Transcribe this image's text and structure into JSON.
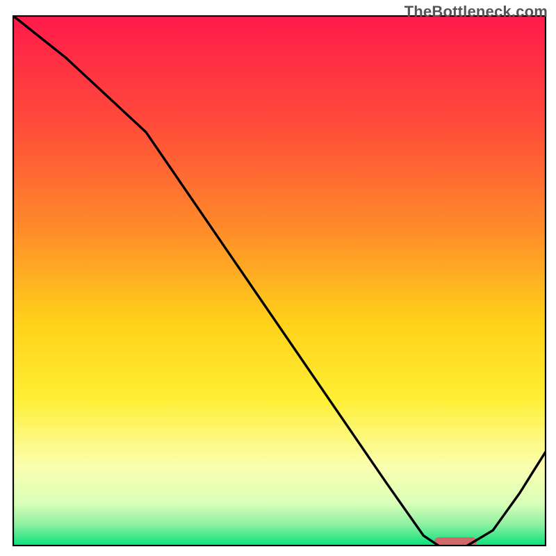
{
  "watermark": "TheBottleneck.com",
  "chart_data": {
    "type": "line",
    "title": "",
    "xlabel": "",
    "ylabel": "",
    "xlim": [
      0,
      100
    ],
    "ylim": [
      0,
      100
    ],
    "grid": false,
    "legend": false,
    "x": [
      0,
      10,
      25,
      40,
      55,
      70,
      77,
      80,
      85,
      90,
      95,
      100
    ],
    "values": [
      100,
      92,
      78,
      56,
      34,
      12,
      2,
      0,
      0,
      3,
      10,
      18
    ],
    "optimum_marker": {
      "x_start": 79,
      "x_end": 87,
      "y": 0.8
    },
    "gradient_stops": [
      {
        "pct": 0,
        "color": "#ff1b4b"
      },
      {
        "pct": 20,
        "color": "#ff4a3a"
      },
      {
        "pct": 40,
        "color": "#ff8a2a"
      },
      {
        "pct": 58,
        "color": "#ffd21a"
      },
      {
        "pct": 72,
        "color": "#ffee33"
      },
      {
        "pct": 85,
        "color": "#fbffb0"
      },
      {
        "pct": 92,
        "color": "#d8ffb8"
      },
      {
        "pct": 96,
        "color": "#8af0a0"
      },
      {
        "pct": 100,
        "color": "#05e07a"
      }
    ],
    "colors": {
      "curve": "#000000",
      "border": "#000000",
      "marker": "#d06a6a"
    }
  }
}
